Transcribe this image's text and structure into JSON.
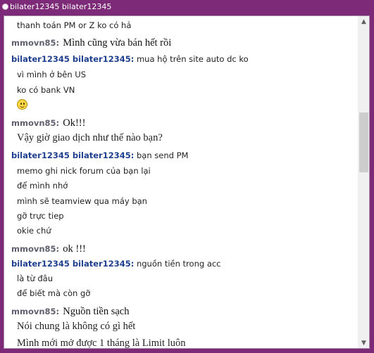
{
  "window": {
    "title": "bilater12345 bilater12345"
  },
  "colors": {
    "title_bar": "#7d2a78",
    "own_name": "#1f3f8f",
    "other_name": "#5f5f6f"
  },
  "messages": [
    {
      "text": "thanh toán PM or Z ko có hả"
    },
    {
      "user": "mmovn85:",
      "text": "Mình cũng vừa bán hết rồi"
    },
    {
      "user": "bilater12345 bilater12345:",
      "text": "mua hộ trên site auto dc ko"
    },
    {
      "text": "vì mình ở bên US"
    },
    {
      "text": "ko có bank VN"
    },
    {
      "icon": "smiley-icon"
    },
    {
      "user": "mmovn85:",
      "text": "Ok!!!"
    },
    {
      "text": "Vậy giờ giao dịch như thế nào bạn?"
    },
    {
      "user": "bilater12345 bilater12345:",
      "text": "bạn send PM"
    },
    {
      "text": "memo ghi nick forum của bạn lại"
    },
    {
      "text": "để mình nhớ"
    },
    {
      "text": "mình sẽ teamview qua máy bạn"
    },
    {
      "text": "gỡ trực tiep"
    },
    {
      "text": "okie chứ"
    },
    {
      "user": "mmovn85:",
      "text": "ok !!!"
    },
    {
      "user": "bilater12345 bilater12345:",
      "text": "nguồn tiền trong acc"
    },
    {
      "text": "là từ đâu"
    },
    {
      "text": "để biết mà còn gỡ"
    },
    {
      "user": "mmovn85:",
      "text": "Nguồn tiền sạch"
    },
    {
      "text": "Nói chung là không có gì hết"
    },
    {
      "text": "Mình mới mở được 1 tháng là Limit luôn"
    }
  ],
  "scrollbar": {
    "up_arrow": "▲",
    "down_arrow": "▼"
  }
}
